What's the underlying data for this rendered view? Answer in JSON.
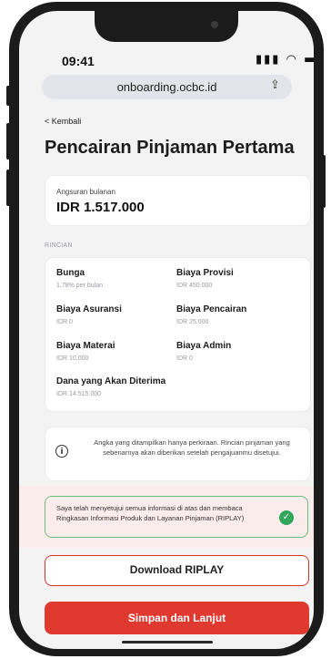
{
  "status_bar": {
    "time": "09:41",
    "icons": "..ıl ᯤ ▬"
  },
  "browser": {
    "url": "onboarding.ocbc.id"
  },
  "page": {
    "back_label": "< Kembali",
    "title": "Pencairan Pinjaman Pertama"
  },
  "monthly": {
    "label": "Angsuran bulanan",
    "value": "IDR 1.517.000"
  },
  "details": {
    "section_label": "RINCIAN",
    "items": [
      {
        "title": "Bunga",
        "value": "1,78% per bulan"
      },
      {
        "title": "Biaya Provisi",
        "value": "IDR 450.000"
      },
      {
        "title": "Biaya Asuransi",
        "value": "IDR 0"
      },
      {
        "title": "Biaya Pencairan",
        "value": "IDR 25.000"
      },
      {
        "title": "Biaya Materai",
        "value": "IDR 10.000"
      },
      {
        "title": "Biaya Admin",
        "value": "IDR 0"
      },
      {
        "title": "Dana yang Akan Diterima",
        "value": "IDR 14.515.000"
      }
    ]
  },
  "info": {
    "icon": "info-icon",
    "text": "Angka yang ditampilkan hanya perkiraan. Rincian pinjaman yang sebenarnya akan diberikan setelah pengajuanmu disetujui."
  },
  "agreement": {
    "text": "Saya telah menyetujui semua informasi di atas dan membaca Ringkasan Informasi Produk dan Layanan Pinjaman (RIPLAY)",
    "checked": true,
    "check_color": "#2fa65a"
  },
  "actions": {
    "download_label": "Download RIPLAY",
    "save_label": "Simpan dan Lanjut",
    "primary_color": "#e03a30"
  }
}
